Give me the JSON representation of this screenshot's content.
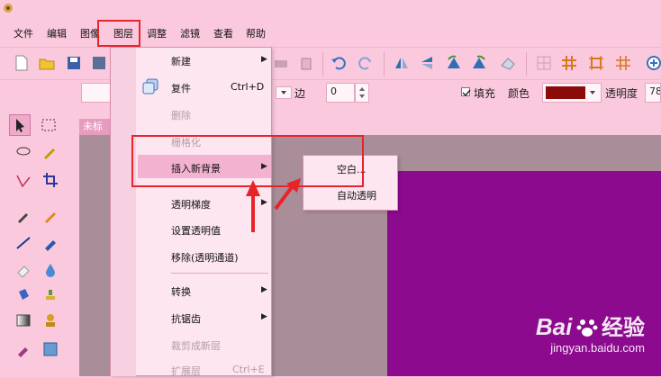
{
  "menubar": {
    "items": [
      "文件",
      "编辑",
      "图像",
      "图层",
      "调整",
      "滤镜",
      "查看",
      "帮助"
    ]
  },
  "propbar": {
    "edge_label": "边",
    "edge_value": "0",
    "fill_label": "填充",
    "fill_checked": true,
    "color_label": "颜色",
    "color_swatch": "#8b0a0a",
    "opacity_label": "透明度",
    "opacity_value": "78"
  },
  "document": {
    "tab_label": "未标"
  },
  "context_menu": {
    "items": [
      {
        "label": "新建",
        "submenu": true,
        "enabled": true
      },
      {
        "label": "复件",
        "shortcut": "Ctrl+D",
        "enabled": true
      },
      {
        "label": "删除",
        "enabled": false
      },
      {
        "label": "栅格化",
        "enabled": false
      },
      {
        "label": "插入新背景",
        "submenu": true,
        "enabled": true,
        "highlighted": true
      },
      {
        "label": "透明梯度",
        "submenu": true,
        "enabled": true
      },
      {
        "label": "设置透明值",
        "enabled": true
      },
      {
        "label": "移除(透明通道)",
        "enabled": true
      },
      {
        "label": "转换",
        "submenu": true,
        "enabled": true
      },
      {
        "label": "抗锯齿",
        "submenu": true,
        "enabled": true
      },
      {
        "label": "裁剪成新层",
        "enabled": false
      },
      {
        "label": "扩展层",
        "shortcut": "Ctrl+E",
        "enabled": false
      }
    ]
  },
  "submenu": {
    "items": [
      "空白...",
      "自动透明"
    ]
  },
  "watermark": {
    "brand": "Bai",
    "brand_cn": "经验",
    "url": "jingyan.baidu.com"
  },
  "colors": {
    "background": "#fbc9de",
    "highlight": "#f3b3d0",
    "canvas": "#8c0a8e",
    "annotation": "#e8232a"
  }
}
